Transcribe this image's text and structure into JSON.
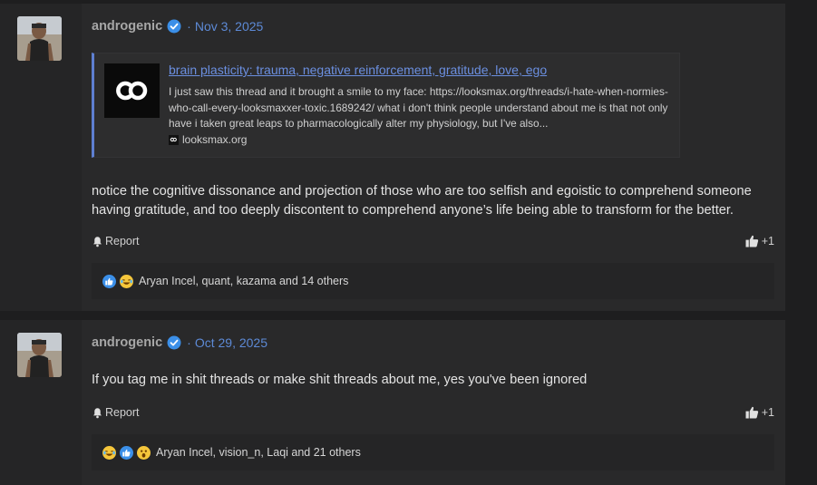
{
  "posts": [
    {
      "username": "androgenic",
      "date": "Nov 3, 2025",
      "embed": {
        "title": "brain plasticity: trauma, negative reinforcement, gratitude, love, ego",
        "description": "I just saw this thread and it brought a smile to my face: https://looksmax.org/threads/i-hate-when-normies-who-call-every-looksmaxxer-toxic.1689242/ what i don't think people understand about me is that not only have i taken great leaps to pharmacologically alter my physiology, but I've also...",
        "site": "looksmax.org"
      },
      "content": "notice the cognitive dissonance and projection of those who are too selfish and egoistic to comprehend someone having gratitude, and too deeply discontent to comprehend anyone’s life being able to transform for the better.",
      "report_label": "Report",
      "react_label": "+1",
      "reactions_text": "Aryan Incel, quant, kazama and 14 others",
      "reaction_icons": [
        "like-emoji-icon",
        "laugh-emoji-icon"
      ]
    },
    {
      "username": "androgenic",
      "date": "Oct 29, 2025",
      "content": "If you tag me in shit threads or make shit threads about me, yes you've been ignored",
      "report_label": "Report",
      "react_label": "+1",
      "reactions_text": "Aryan Incel, vision_n, Laqi and 21 others",
      "reaction_icons": [
        "laugh-emoji-icon",
        "like-emoji-icon",
        "wow-emoji-icon"
      ]
    }
  ],
  "colors": {
    "accent": "#5d8ad6",
    "link": "#6b8fe0",
    "background": "#1e1e1f",
    "post": "#29292a",
    "verified": "#3b8fe8"
  }
}
